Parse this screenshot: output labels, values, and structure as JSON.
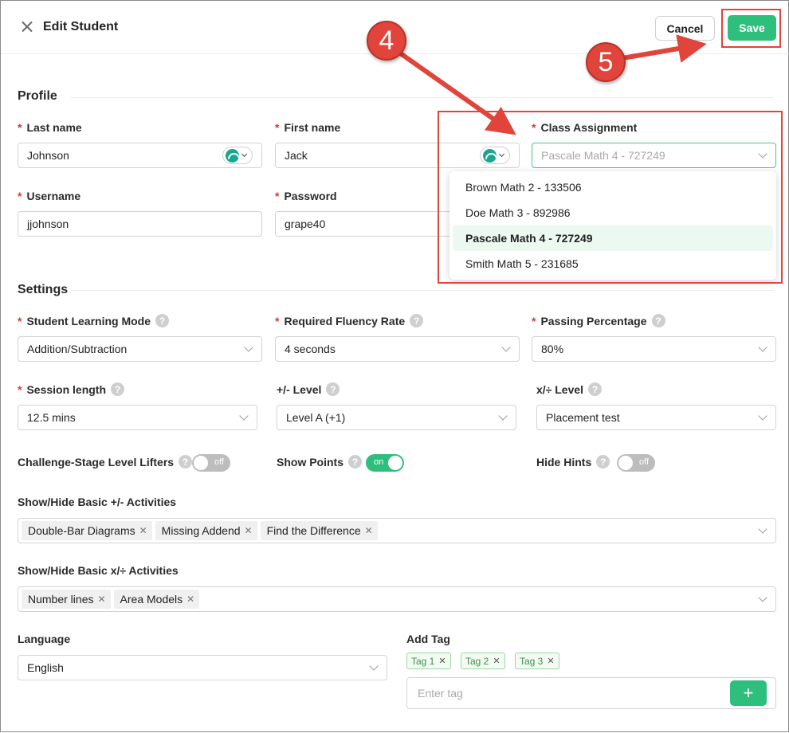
{
  "header": {
    "title": "Edit Student",
    "cancel_label": "Cancel",
    "save_label": "Save"
  },
  "profile": {
    "section_title": "Profile",
    "last_name": {
      "label": "Last name",
      "value": "Johnson"
    },
    "first_name": {
      "label": "First name",
      "value": "Jack"
    },
    "class_assignment": {
      "label": "Class Assignment",
      "value": "Pascale Math 4 - 727249",
      "options": [
        "Brown Math 2 - 133506",
        "Doe Math 3 - 892986",
        "Pascale Math 4 - 727249",
        "Smith Math 5 - 231685"
      ]
    },
    "username": {
      "label": "Username",
      "value": "jjohnson"
    },
    "password": {
      "label": "Password",
      "value": "grape40"
    }
  },
  "settings": {
    "section_title": "Settings",
    "learning_mode": {
      "label": "Student Learning Mode",
      "value": "Addition/Subtraction"
    },
    "fluency_rate": {
      "label": "Required Fluency Rate",
      "value": "4 seconds"
    },
    "passing_percentage": {
      "label": "Passing Percentage",
      "value": "80%"
    },
    "session_length": {
      "label": "Session length",
      "value": "12.5 mins"
    },
    "addsub_level": {
      "label": "+/- Level",
      "value": "Level A (+1)"
    },
    "muldiv_level": {
      "label": "x/÷ Level",
      "value": "Placement test"
    },
    "level_lifters": {
      "label": "Challenge-Stage Level Lifters",
      "state": "off"
    },
    "show_points": {
      "label": "Show Points",
      "state": "on"
    },
    "hide_hints": {
      "label": "Hide Hints",
      "state": "off"
    },
    "basic_addsub": {
      "label": "Show/Hide Basic +/- Activities",
      "chips": [
        "Double-Bar Diagrams",
        "Missing Addend",
        "Find the Difference"
      ]
    },
    "basic_muldiv": {
      "label": "Show/Hide Basic x/÷ Activities",
      "chips": [
        "Number lines",
        "Area Models"
      ]
    },
    "language": {
      "label": "Language",
      "value": "English"
    },
    "add_tag": {
      "label": "Add Tag",
      "tags": [
        "Tag 1",
        "Tag 2",
        "Tag 3"
      ],
      "placeholder": "Enter tag",
      "add_symbol": "+"
    }
  },
  "help_symbol": "?",
  "annotations": {
    "step4": "4",
    "step5": "5",
    "color": "#e0443a"
  },
  "colors": {
    "accent": "#2fbf7d",
    "required": "#e3352b"
  }
}
